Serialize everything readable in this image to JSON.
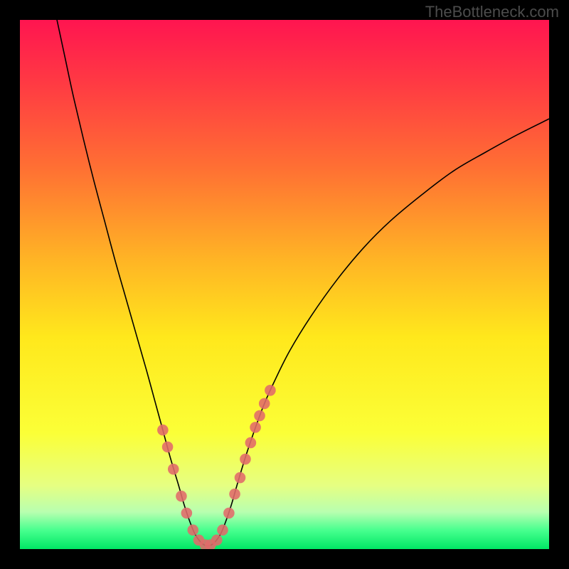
{
  "watermark": {
    "text": "TheBottleneck.com"
  },
  "chart_data": {
    "type": "line",
    "title": "",
    "xlabel": "",
    "ylabel": "",
    "xlim": [
      0,
      100
    ],
    "ylim": [
      0,
      100
    ],
    "background_gradient": {
      "stops": [
        {
          "offset": 0.0,
          "color": "#ff1550"
        },
        {
          "offset": 0.12,
          "color": "#ff3a43"
        },
        {
          "offset": 0.28,
          "color": "#ff7033"
        },
        {
          "offset": 0.45,
          "color": "#ffb325"
        },
        {
          "offset": 0.6,
          "color": "#ffe81c"
        },
        {
          "offset": 0.78,
          "color": "#fbff37"
        },
        {
          "offset": 0.88,
          "color": "#e6ff82"
        },
        {
          "offset": 0.93,
          "color": "#b8ffb0"
        },
        {
          "offset": 0.965,
          "color": "#46ff8e"
        },
        {
          "offset": 1.0,
          "color": "#00e765"
        }
      ]
    },
    "series": [
      {
        "name": "curve",
        "type": "line",
        "stroke": "#000000",
        "stroke_width": 1.6,
        "points": [
          {
            "x": 7.0,
            "y": 100.0
          },
          {
            "x": 8.5,
            "y": 93.0
          },
          {
            "x": 10.0,
            "y": 86.0
          },
          {
            "x": 12.0,
            "y": 77.5
          },
          {
            "x": 14.0,
            "y": 69.5
          },
          {
            "x": 16.0,
            "y": 62.0
          },
          {
            "x": 18.0,
            "y": 54.5
          },
          {
            "x": 20.0,
            "y": 47.5
          },
          {
            "x": 22.0,
            "y": 40.5
          },
          {
            "x": 24.0,
            "y": 33.5
          },
          {
            "x": 25.5,
            "y": 28.0
          },
          {
            "x": 27.0,
            "y": 22.5
          },
          {
            "x": 28.5,
            "y": 17.0
          },
          {
            "x": 30.0,
            "y": 12.0
          },
          {
            "x": 31.0,
            "y": 8.5
          },
          {
            "x": 32.0,
            "y": 5.5
          },
          {
            "x": 33.0,
            "y": 3.0
          },
          {
            "x": 34.0,
            "y": 1.5
          },
          {
            "x": 35.0,
            "y": 0.7
          },
          {
            "x": 36.0,
            "y": 0.7
          },
          {
            "x": 37.0,
            "y": 1.5
          },
          {
            "x": 38.0,
            "y": 3.0
          },
          {
            "x": 39.0,
            "y": 5.5
          },
          {
            "x": 40.0,
            "y": 8.5
          },
          {
            "x": 41.0,
            "y": 12.0
          },
          {
            "x": 42.5,
            "y": 17.0
          },
          {
            "x": 44.0,
            "y": 21.5
          },
          {
            "x": 46.0,
            "y": 27.0
          },
          {
            "x": 48.0,
            "y": 31.5
          },
          {
            "x": 51.0,
            "y": 37.5
          },
          {
            "x": 55.0,
            "y": 44.0
          },
          {
            "x": 60.0,
            "y": 51.0
          },
          {
            "x": 65.0,
            "y": 57.0
          },
          {
            "x": 70.0,
            "y": 62.0
          },
          {
            "x": 76.0,
            "y": 67.0
          },
          {
            "x": 82.0,
            "y": 71.5
          },
          {
            "x": 88.0,
            "y": 75.0
          },
          {
            "x": 94.0,
            "y": 78.3
          },
          {
            "x": 100.0,
            "y": 81.3
          }
        ]
      },
      {
        "name": "highlight-markers",
        "type": "scatter",
        "stroke": "#e16a6a",
        "fill": "#e16a6a",
        "radius": 7.8,
        "points": [
          {
            "x": 27.0,
            "y": 22.5
          },
          {
            "x": 27.9,
            "y": 19.3
          },
          {
            "x": 29.0,
            "y": 15.1
          },
          {
            "x": 30.5,
            "y": 10.0
          },
          {
            "x": 31.5,
            "y": 6.8
          },
          {
            "x": 32.7,
            "y": 3.6
          },
          {
            "x": 33.8,
            "y": 1.7
          },
          {
            "x": 35.0,
            "y": 0.8
          },
          {
            "x": 36.0,
            "y": 0.8
          },
          {
            "x": 37.2,
            "y": 1.7
          },
          {
            "x": 38.3,
            "y": 3.6
          },
          {
            "x": 39.5,
            "y": 6.8
          },
          {
            "x": 40.6,
            "y": 10.4
          },
          {
            "x": 41.6,
            "y": 13.5
          },
          {
            "x": 42.6,
            "y": 17.0
          },
          {
            "x": 43.6,
            "y": 20.1
          },
          {
            "x": 44.5,
            "y": 23.0
          },
          {
            "x": 45.3,
            "y": 25.2
          },
          {
            "x": 46.2,
            "y": 27.5
          },
          {
            "x": 47.3,
            "y": 30.0
          }
        ]
      }
    ]
  }
}
